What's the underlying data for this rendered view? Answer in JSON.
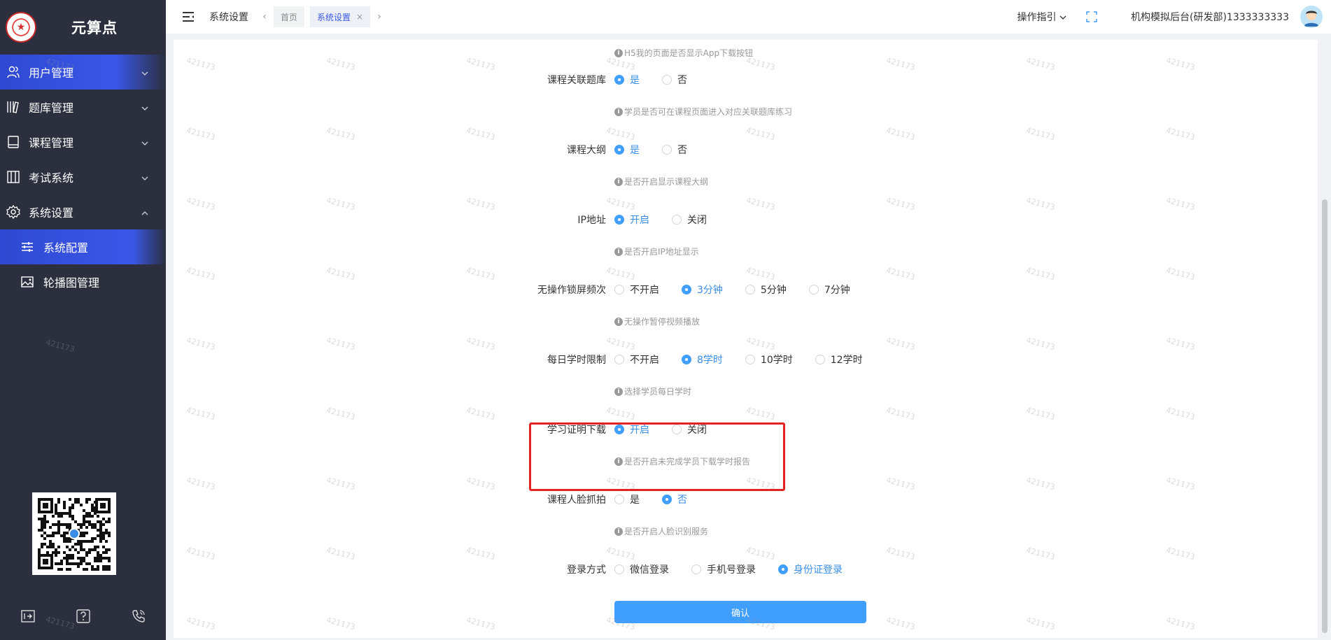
{
  "app": {
    "brand_name": "元算点",
    "logo_glyph": "★"
  },
  "sidebar": {
    "items": [
      {
        "label": "用户管理",
        "icon": "users-icon",
        "active": true,
        "expanded": false
      },
      {
        "label": "题库管理",
        "icon": "books-icon",
        "active": false,
        "expanded": false
      },
      {
        "label": "课程管理",
        "icon": "book-icon",
        "active": false,
        "expanded": false
      },
      {
        "label": "考试系统",
        "icon": "exam-icon",
        "active": false,
        "expanded": false
      },
      {
        "label": "系统设置",
        "icon": "gear-icon",
        "active": false,
        "expanded": true
      }
    ],
    "subitems": [
      {
        "label": "系统配置",
        "icon": "sliders-icon",
        "active": true
      },
      {
        "label": "轮播图管理",
        "icon": "image-icon",
        "active": false
      }
    ],
    "bottom_icons": [
      "log-icon",
      "help-icon",
      "phone-icon"
    ],
    "watermark": "421173"
  },
  "topbar": {
    "breadcrumb": "系统设置",
    "tabs": [
      {
        "label": "首页",
        "active": false,
        "closable": false
      },
      {
        "label": "系统设置",
        "active": true,
        "closable": true
      }
    ],
    "close_glyph": "×",
    "prev_glyph": "‹",
    "next_glyph": "›",
    "guide_label": "操作指引",
    "org_label": "机构模拟后台(研发部)1333333333"
  },
  "form": {
    "top_hint": "H5我的页面是否显示App下载按钮",
    "rows": [
      {
        "label": "课程关联题库",
        "options": [
          "是",
          "否"
        ],
        "selected": 0,
        "hint": "学员是否可在课程页面进入对应关联题库练习"
      },
      {
        "label": "课程大纲",
        "options": [
          "是",
          "否"
        ],
        "selected": 0,
        "hint": "是否开启显示课程大纲"
      },
      {
        "label": "IP地址",
        "options": [
          "开启",
          "关闭"
        ],
        "selected": 0,
        "hint": "是否开启IP地址显示"
      },
      {
        "label": "无操作锁屏频次",
        "options": [
          "不开启",
          "3分钟",
          "5分钟",
          "7分钟"
        ],
        "selected": 1,
        "hint": "无操作暂停视频播放"
      },
      {
        "label": "每日学时限制",
        "options": [
          "不开启",
          "8学时",
          "10学时",
          "12学时"
        ],
        "selected": 1,
        "hint": "选择学员每日学时"
      },
      {
        "label": "学习证明下载",
        "options": [
          "开启",
          "关闭"
        ],
        "selected": 0,
        "hint": "是否开启未完成学员下载学时报告"
      },
      {
        "label": "课程人脸抓拍",
        "options": [
          "是",
          "否"
        ],
        "selected": 1,
        "hint": "是否开启人脸识别服务"
      },
      {
        "label": "登录方式",
        "options": [
          "微信登录",
          "手机号登录",
          "身份证登录"
        ],
        "selected": 2,
        "hint": ""
      }
    ],
    "info_glyph": "i",
    "confirm_label": "确认"
  },
  "colors": {
    "sidebar_bg": "#2b2f3e",
    "accent": "#409eff",
    "active_menu": "#3a57e8",
    "highlight_box": "#e52222"
  }
}
